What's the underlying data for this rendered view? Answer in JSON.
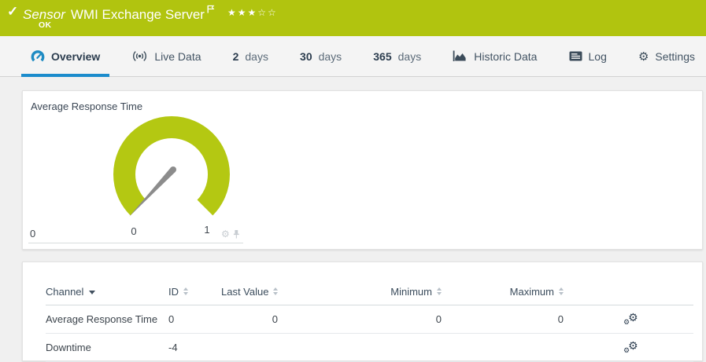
{
  "colors": {
    "banner_green": "#b1c40f",
    "gauge_green": "#b4c812",
    "active_tab_blue": "#1b8ccc",
    "needle_grey": "#8c8c8c"
  },
  "icons": {
    "check": "✓",
    "gear": "⚙",
    "stars": "★★★☆☆"
  },
  "header": {
    "kind": "Sensor",
    "title": "WMI Exchange Server",
    "status": "OK",
    "priority_filled": 3,
    "priority_total": 5
  },
  "tabs": {
    "overview": "Overview",
    "live_data": "Live Data",
    "d2_num": "2",
    "d2_label": "days",
    "d30_num": "30",
    "d30_label": "days",
    "d365_num": "365",
    "d365_label": "days",
    "historic": "Historic Data",
    "log": "Log",
    "settings": "Settings"
  },
  "gauge_panel": {
    "title": "Average Response Time",
    "value": 0,
    "scale_min": "0",
    "scale_max": "1",
    "axis_min": "0"
  },
  "table": {
    "headers": {
      "channel": "Channel",
      "id": "ID",
      "last_value": "Last Value",
      "minimum": "Minimum",
      "maximum": "Maximum"
    },
    "rows": [
      {
        "channel": "Average Response Time",
        "id": "0",
        "last_value": "0",
        "minimum": "0",
        "maximum": "0"
      },
      {
        "channel": "Downtime",
        "id": "-4",
        "last_value": "",
        "minimum": "",
        "maximum": ""
      }
    ]
  }
}
